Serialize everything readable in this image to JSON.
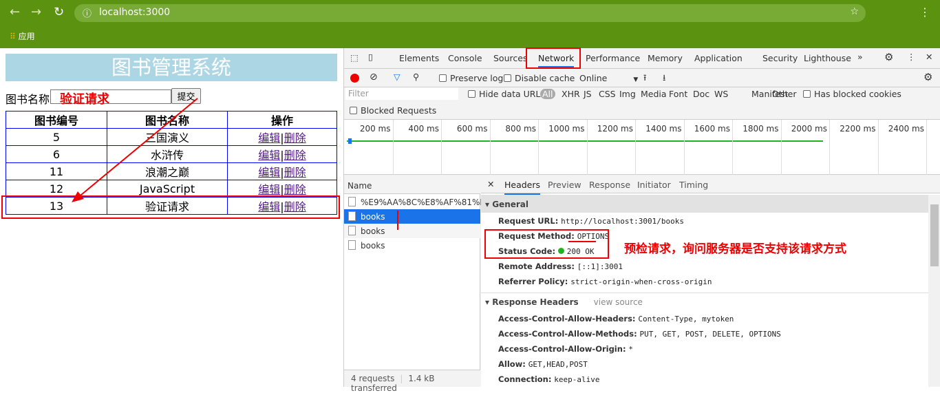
{
  "browser": {
    "url": "localhost:3000",
    "bookmarks": [
      {
        "label": "应用"
      }
    ]
  },
  "page": {
    "title": "图书管理系统",
    "form": {
      "label": "图书名称",
      "input_value": "",
      "submit": "提交"
    },
    "table": {
      "headers": [
        "图书编号",
        "图书名称",
        "操作"
      ],
      "rows": [
        {
          "id": "5",
          "name": "三国演义"
        },
        {
          "id": "6",
          "name": "水浒传"
        },
        {
          "id": "11",
          "name": "浪潮之巅"
        },
        {
          "id": "12",
          "name": "JavaScript"
        },
        {
          "id": "13",
          "name": "验证请求"
        }
      ],
      "edit": "编辑",
      "sep": "|",
      "delete": "删除"
    }
  },
  "devtools": {
    "tabs": [
      "Elements",
      "Console",
      "Sources",
      "Network",
      "Performance",
      "Memory",
      "Application",
      "Security",
      "Lighthouse"
    ],
    "active_tab": "Network",
    "toolbar": {
      "preserve_log": "Preserve log",
      "disable_cache": "Disable cache",
      "throttle": "Online"
    },
    "filter": {
      "placeholder": "Filter",
      "hide_data_urls": "Hide data URLs",
      "types": [
        "All",
        "XHR",
        "JS",
        "CSS",
        "Img",
        "Media",
        "Font",
        "Doc",
        "WS",
        "Manifest",
        "Other"
      ],
      "has_blocked_cookies": "Has blocked cookies",
      "blocked_requests": "Blocked Requests"
    },
    "timeline": [
      "200 ms",
      "400 ms",
      "600 ms",
      "800 ms",
      "1000 ms",
      "1200 ms",
      "1400 ms",
      "1600 ms",
      "1800 ms",
      "2000 ms",
      "2200 ms",
      "2400 ms"
    ],
    "list": {
      "header": "Name",
      "items": [
        "%E9%AA%8C%E8%AF%81%E...",
        "books",
        "books",
        "books"
      ],
      "selected": 1,
      "footer_requests": "4 requests",
      "footer_transferred": "1.4 kB transferred"
    },
    "detail_tabs": [
      "Headers",
      "Preview",
      "Response",
      "Initiator",
      "Timing"
    ],
    "general": {
      "title": "General",
      "items": [
        {
          "k": "Request URL:",
          "v": "http://localhost:3001/books"
        },
        {
          "k": "Request Method:",
          "v": "OPTIONS"
        },
        {
          "k": "Status Code:",
          "v": "200 OK"
        },
        {
          "k": "Remote Address:",
          "v": "[::1]:3001"
        },
        {
          "k": "Referrer Policy:",
          "v": "strict-origin-when-cross-origin"
        }
      ]
    },
    "response_headers": {
      "title": "Response Headers",
      "view_source": "view source",
      "items": [
        {
          "k": "Access-Control-Allow-Headers:",
          "v": "Content-Type, mytoken"
        },
        {
          "k": "Access-Control-Allow-Methods:",
          "v": "PUT, GET, POST, DELETE, OPTIONS"
        },
        {
          "k": "Access-Control-Allow-Origin:",
          "v": "*"
        },
        {
          "k": "Allow:",
          "v": "GET,HEAD,POST"
        },
        {
          "k": "Connection:",
          "v": "keep-alive"
        }
      ]
    }
  },
  "annotations": {
    "input_note": "验证请求",
    "preflight_note": "预检请求，询问服务器是否支持该请求方式"
  },
  "colors": {
    "chrome": "#5b9310",
    "accent": "#1a73e8",
    "annotation": "#e00000",
    "status_ok": "#1db51d"
  }
}
